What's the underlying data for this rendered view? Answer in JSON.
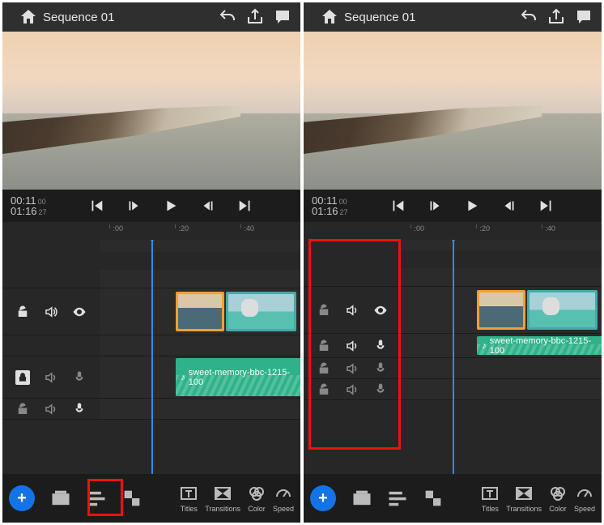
{
  "header": {
    "title": "Sequence 01"
  },
  "timecode": {
    "current": "00:11",
    "current_frames": "00",
    "total": "01:16",
    "total_frames": "27"
  },
  "ruler": {
    "ticks": [
      ":00",
      ":20",
      ":40"
    ]
  },
  "clips": {
    "audio_label": "sweet-memory-bbc-1215-100"
  },
  "toolbar": {
    "titles": "Titles",
    "transitions": "Transitions",
    "color": "Color",
    "speed": "Speed"
  }
}
